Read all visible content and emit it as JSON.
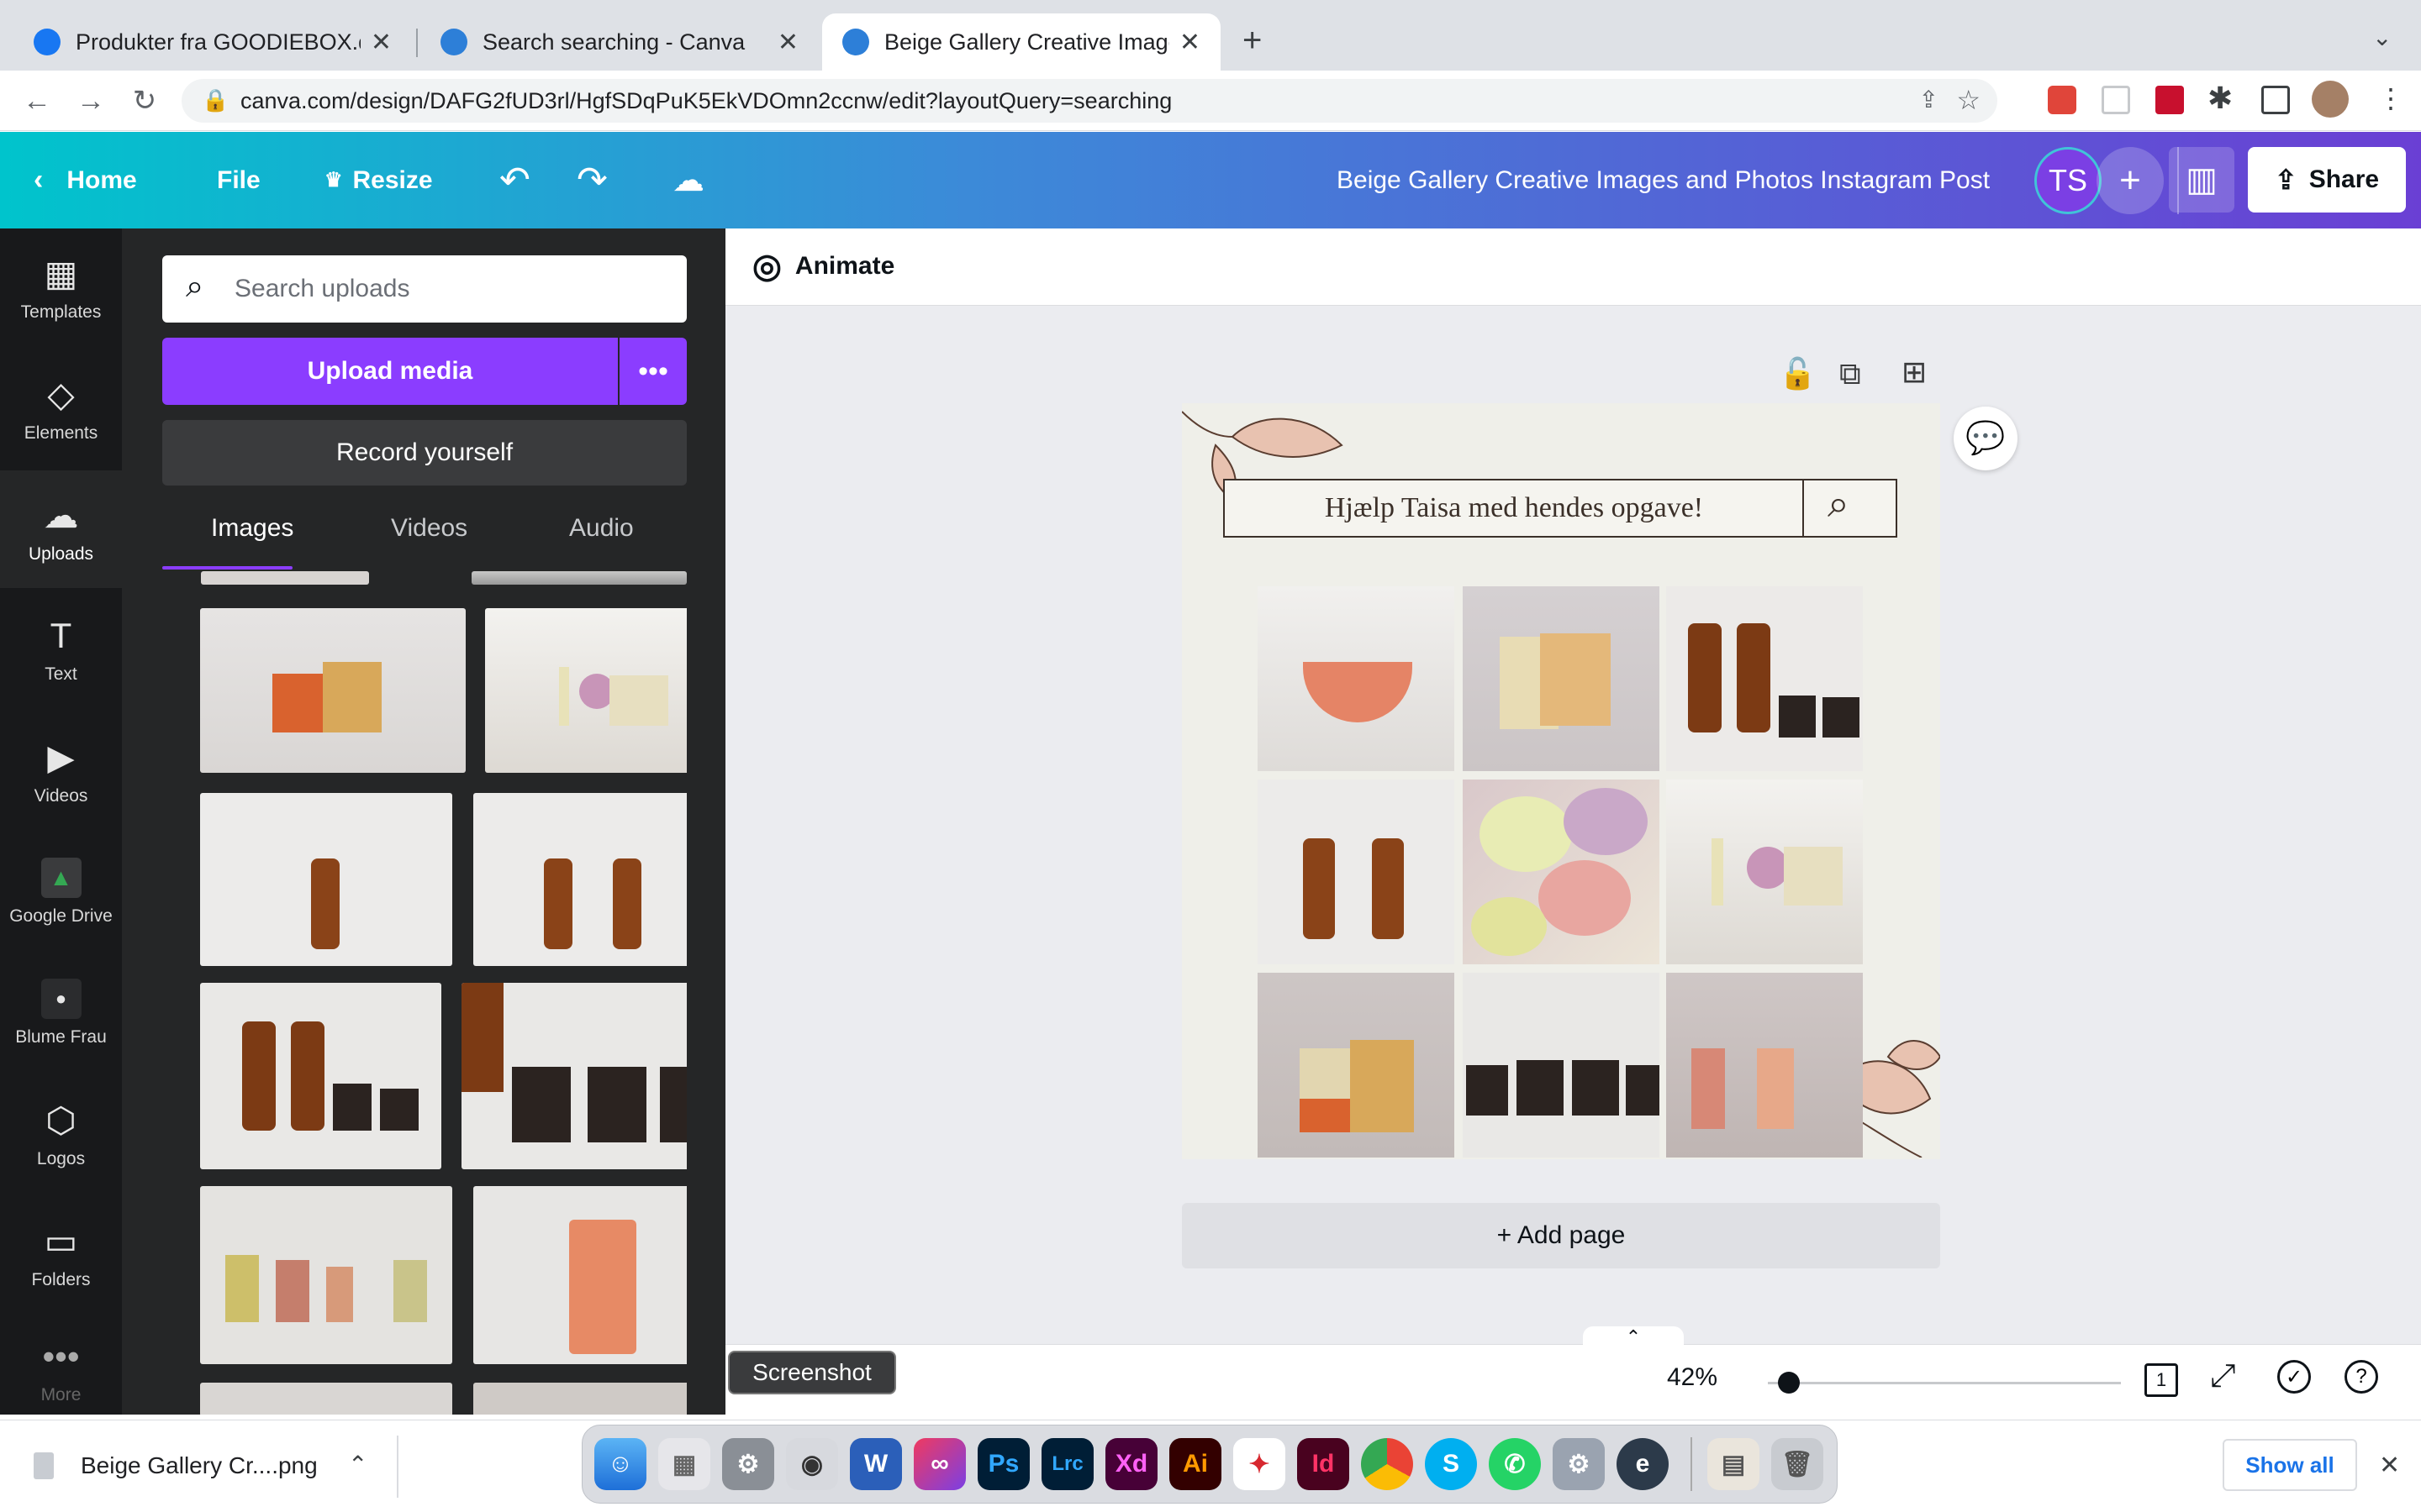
{
  "browser": {
    "tabs": [
      {
        "title": "Produkter fra GOODIEBOX.dk (",
        "favicon_color": "#1877f2"
      },
      {
        "title": "Search searching - Canva",
        "favicon_color": "#2d7fd8"
      },
      {
        "title": "Beige Gallery Creative Images",
        "favicon_color": "#2d7fd8"
      }
    ],
    "new_tab": "+",
    "url": "canva.com/design/DAFG2fUD3rl/HgfSDqPuK5EkVDOmn2ccnw/edit?layoutQuery=searching"
  },
  "header": {
    "home": "Home",
    "file": "File",
    "resize": "Resize",
    "doc_title": "Beige Gallery Creative Images and Photos Instagram Post",
    "avatar": "TS",
    "share": "Share"
  },
  "rail": [
    {
      "label": "Templates",
      "icon": "templates-icon"
    },
    {
      "label": "Elements",
      "icon": "elements-icon"
    },
    {
      "label": "Uploads",
      "icon": "upload-cloud-icon"
    },
    {
      "label": "Text",
      "icon": "text-icon"
    },
    {
      "label": "Videos",
      "icon": "video-icon"
    },
    {
      "label": "Google Drive",
      "icon": "google-drive-icon"
    },
    {
      "label": "Blume Frau",
      "icon": "blume-frau-icon"
    },
    {
      "label": "Logos",
      "icon": "logos-icon"
    },
    {
      "label": "Folders",
      "icon": "folder-icon"
    },
    {
      "label": "More",
      "icon": "more-icon"
    }
  ],
  "panel": {
    "search_placeholder": "Search uploads",
    "upload_button": "Upload media",
    "record_button": "Record yourself",
    "tabs": [
      "Images",
      "Videos",
      "Audio"
    ]
  },
  "editor": {
    "animate": "Animate",
    "design_search_text": "Hjælp Taisa med hendes opgave!",
    "add_page": "+ Add page",
    "zoom": "42%",
    "page_count": "1",
    "tooltip": "Screenshot"
  },
  "downloads": {
    "file": "Beige Gallery Cr....png",
    "show_all": "Show all"
  },
  "dock": [
    "Finder",
    "Launchpad",
    "System Preferences",
    "Screenshot",
    "Word",
    "Creative Cloud",
    "Ps",
    "Lrc",
    "Xd",
    "Ai",
    "Acrobat",
    "Id",
    "Chrome",
    "Skype",
    "WhatsApp",
    "Settings",
    "Evernote",
    "Downloads",
    "Trash"
  ]
}
